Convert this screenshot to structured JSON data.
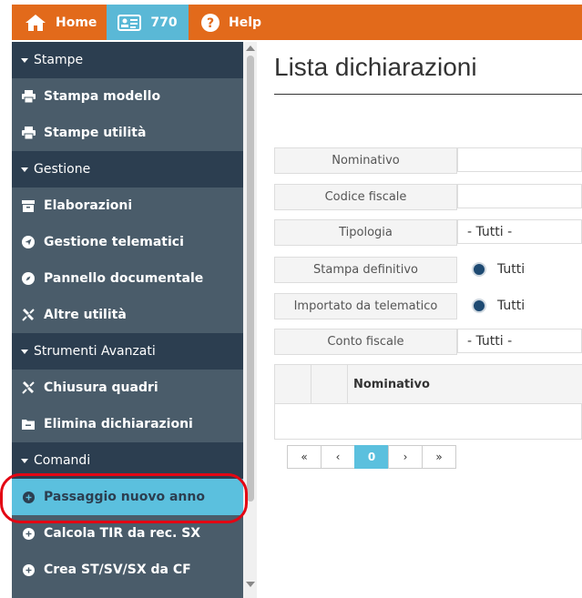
{
  "topbar": {
    "home_label": "Home",
    "count_label": "770",
    "help_label": "Help"
  },
  "sidebar": {
    "entries": [
      {
        "kind": "section",
        "label": "Stampe"
      },
      {
        "kind": "item",
        "label": "Stampa modello",
        "icon": "printer-icon"
      },
      {
        "kind": "item",
        "label": "Stampe utilità",
        "icon": "printer-icon"
      },
      {
        "kind": "section",
        "label": "Gestione"
      },
      {
        "kind": "item",
        "label": "Elaborazioni",
        "icon": "archive-icon"
      },
      {
        "kind": "item",
        "label": "Gestione telematici",
        "icon": "send-icon"
      },
      {
        "kind": "item",
        "label": "Pannello documentale",
        "icon": "compass-icon"
      },
      {
        "kind": "item",
        "label": "Altre utilità",
        "icon": "tools-icon"
      },
      {
        "kind": "section",
        "label": "Strumenti Avanzati"
      },
      {
        "kind": "item",
        "label": "Chiusura quadri",
        "icon": "tools-icon"
      },
      {
        "kind": "item",
        "label": "Elimina dichiarazioni",
        "icon": "folder-minus-icon"
      },
      {
        "kind": "section",
        "label": "Comandi"
      },
      {
        "kind": "item",
        "label": "Passaggio nuovo anno",
        "icon": "plus-circle-icon",
        "active": true
      },
      {
        "kind": "item",
        "label": "Calcola TIR da rec. SX",
        "icon": "plus-circle-icon"
      },
      {
        "kind": "item",
        "label": "Crea ST/SV/SX da CF",
        "icon": "plus-circle-icon"
      }
    ]
  },
  "main": {
    "title": "Lista dichiarazioni",
    "filters": {
      "nominativo": {
        "label": "Nominativo",
        "value": ""
      },
      "codice_fiscale": {
        "label": "Codice fiscale",
        "value": ""
      },
      "tipologia": {
        "label": "Tipologia",
        "value": "- Tutti -"
      },
      "stampa_definitivo": {
        "label": "Stampa definitivo",
        "value": "Tutti"
      },
      "importato": {
        "label": "Importato da telematico",
        "value": "Tutti"
      },
      "conto_fiscale": {
        "label": "Conto fiscale",
        "value": "- Tutti -"
      }
    },
    "table": {
      "col_name": "Nominativo"
    },
    "pager": {
      "first": "«",
      "prev": "‹",
      "current": "0",
      "next": "›",
      "last": "»"
    }
  },
  "colors": {
    "topbar": "#e26a1b",
    "accent": "#5bc0de",
    "sidebar_section": "#2c3e50",
    "sidebar_item": "#4a5c6a",
    "highlight": "#e30613"
  }
}
